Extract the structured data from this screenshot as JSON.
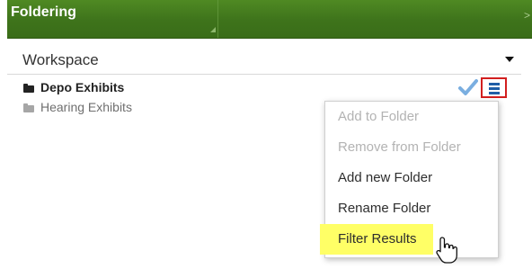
{
  "header": {
    "title": "Foldering",
    "collapse_glyph": ">"
  },
  "workspace": {
    "label": "Workspace",
    "caret_icon": "caret-down-icon"
  },
  "folders": [
    {
      "label": "Depo Exhibits",
      "selected": true,
      "icon": "folder-icon"
    },
    {
      "label": "Hearing Exhibits",
      "selected": false,
      "icon": "folder-icon"
    }
  ],
  "actions": {
    "check_icon": "checkmark-icon",
    "menu_icon": "list-menu-icon"
  },
  "menu": {
    "items": [
      {
        "label": "Add to Folder",
        "enabled": false
      },
      {
        "label": "Remove from Folder",
        "enabled": false
      },
      {
        "label": "Add new Folder",
        "enabled": true
      },
      {
        "label": "Rename Folder",
        "enabled": true
      },
      {
        "label": "Filter Results",
        "enabled": true,
        "highlighted": true
      }
    ]
  },
  "colors": {
    "header_green": "#3e731b",
    "menu_border": "#d21f1f",
    "menu_icon_blue": "#1f5ea7",
    "check_blue": "#7aaee0",
    "highlight": "#ffff66"
  }
}
